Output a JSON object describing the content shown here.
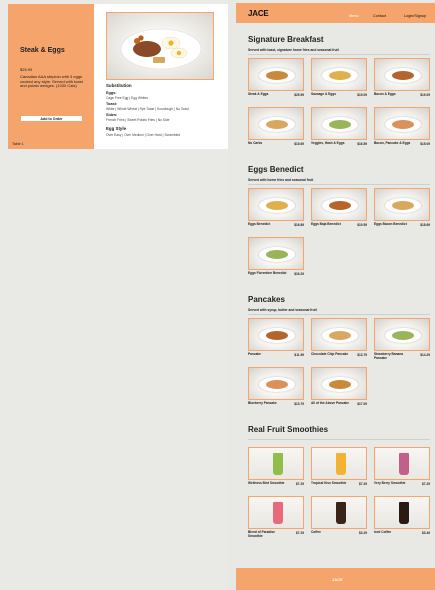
{
  "modal": {
    "item_name": "Steak & Eggs",
    "price": "$25.99",
    "description": "Canadian AAA striploin with 3 eggs cooked any style. Served with toast and potato wedges. (1030 Cals)",
    "add_button": "Add to Order",
    "table": "Table 1",
    "substitution_title": "Substitution",
    "eggs_label": "Eggs:",
    "eggs_options": "Cage Free Egg | Egg Whites",
    "toast_label": "Toast:",
    "toast_options": "White | Whole Wheat | Rye Toast | Sourdough | No Toast",
    "sides_label": "Sides:",
    "sides_options": "French Fries | Sweet Potato Fries | No Side",
    "egg_style_title": "Egg Style",
    "egg_style_options": "Over Easy | Over Medium | Over Hard | Scrambled"
  },
  "nav": {
    "logo": "JACE",
    "links": [
      "Menu",
      "Contact",
      "Login/Signup"
    ]
  },
  "sections": [
    {
      "title": "Signature Breakfast",
      "subtitle": "Served with toast, signature home fries and seasonal fruit",
      "items": [
        {
          "name": "Steak & Eggs",
          "price": "$25.99"
        },
        {
          "name": "Sausage & Eggs",
          "price": "$19.09"
        },
        {
          "name": "Bacon & Eggs",
          "price": "$19.09"
        },
        {
          "name": "No Carbs",
          "price": "$15.69"
        },
        {
          "name": "Veggies, Hash & Eggs",
          "price": "$16.59"
        },
        {
          "name": "Bacon, Pancake & Eggs",
          "price": "$15.09"
        }
      ]
    },
    {
      "title": "Eggs Benedict",
      "subtitle": "Served with home fries and seasonal fruit",
      "items": [
        {
          "name": "Eggs Benedict",
          "price": "$16.89"
        },
        {
          "name": "Eggs Baja Benedict",
          "price": "$19.59"
        },
        {
          "name": "Eggs Bacon Benedict",
          "price": "$18.69"
        },
        {
          "name": "Eggs Florentine Benedict",
          "price": "$16.29"
        }
      ]
    },
    {
      "title": "Pancakes",
      "subtitle": "Served with syrup, butter and seasonal fruit",
      "items": [
        {
          "name": "Pancake",
          "price": "$11.59"
        },
        {
          "name": "Chocolate Chip Pancake",
          "price": "$13.79"
        },
        {
          "name": "Strawberry Banana Pancake",
          "price": "$14.29"
        },
        {
          "name": "Blueberry Pancake",
          "price": "$13.79"
        },
        {
          "name": "All of the Above Pancake",
          "price": "$17.09"
        }
      ]
    },
    {
      "title": "Real Fruit Smoothies",
      "subtitle": "",
      "items": [
        {
          "name": "Wellness Bird Smoothie",
          "price": "$7.29"
        },
        {
          "name": "Tropical Kiss Smoothie",
          "price": "$7.29"
        },
        {
          "name": "Very Berry Smoothie",
          "price": "$7.29"
        },
        {
          "name": "Blend of Paradise Smoothie",
          "price": "$7.29"
        },
        {
          "name": "Coffee",
          "price": "$3.29"
        },
        {
          "name": "Iced Coffee",
          "price": "$3.49"
        }
      ]
    }
  ],
  "footer": {
    "logo": "JACE"
  },
  "colors": {
    "accent": "#f5a46c",
    "background": "#e8e8e5"
  }
}
